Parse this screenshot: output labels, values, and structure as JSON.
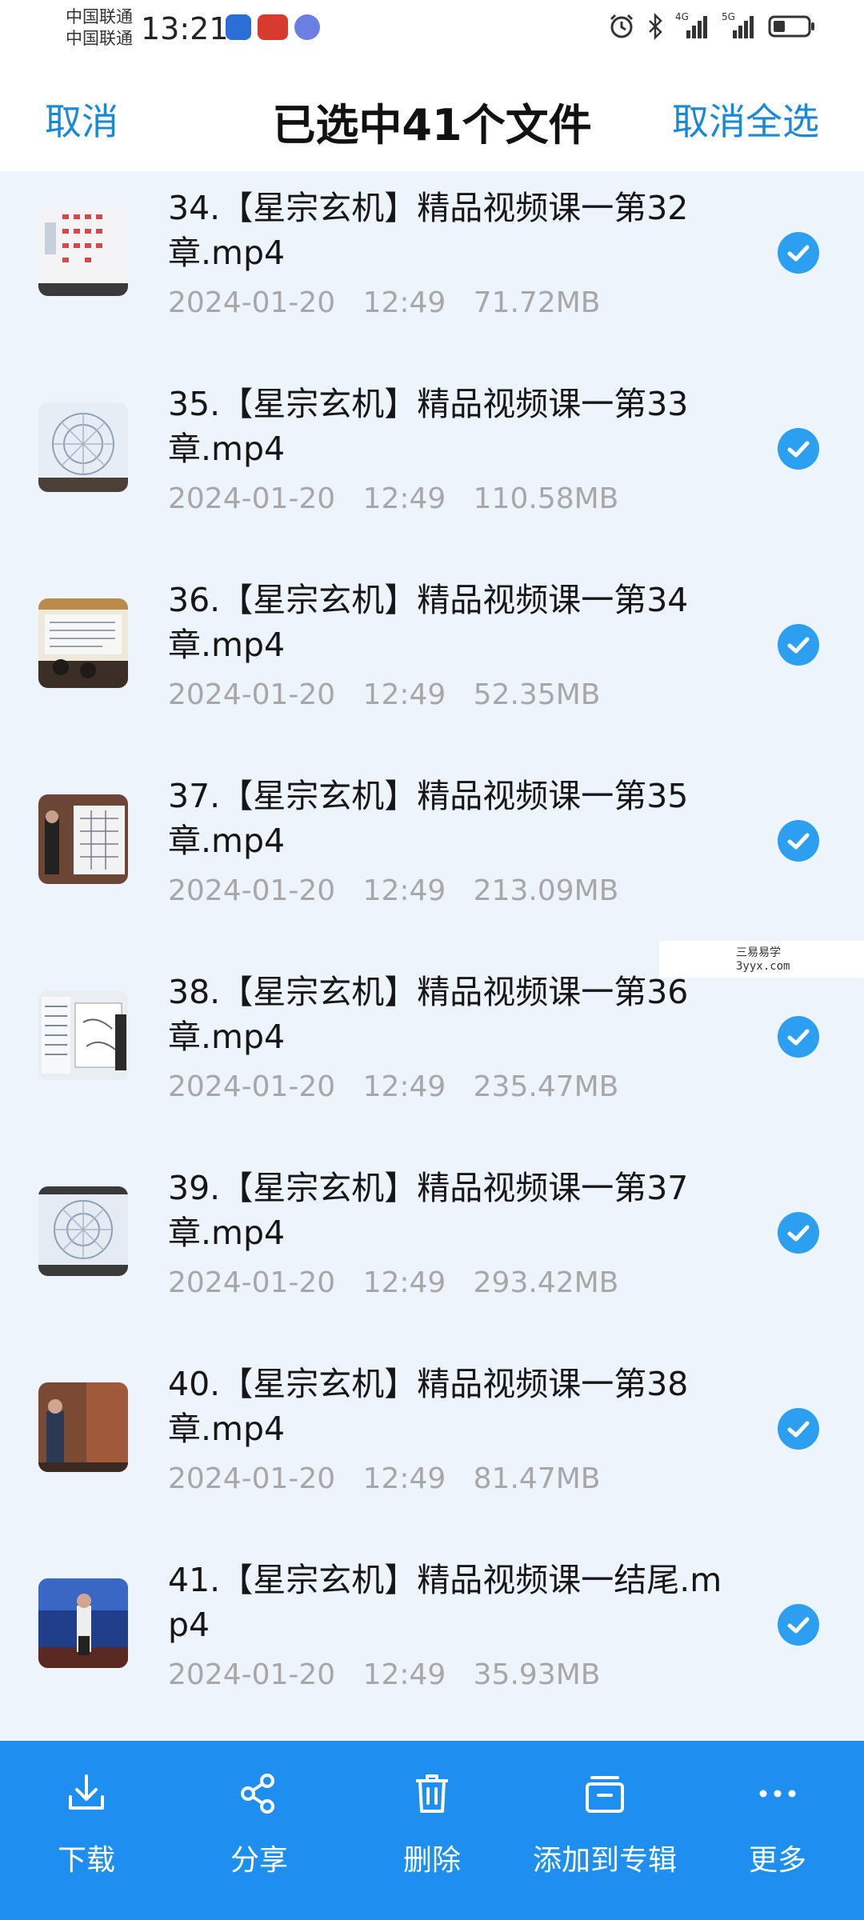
{
  "status_bar": {
    "carrier1": "中国联通",
    "carrier2": "中国联通",
    "time": "13:21",
    "net1": "4G",
    "net2": "5G"
  },
  "header": {
    "cancel": "取消",
    "title": "已选中41个文件",
    "deselect_all": "取消全选"
  },
  "files": [
    {
      "name": "34.【星宗玄机】精品视频课一第32章.mp4",
      "date": "2024-01-20",
      "time": "12:49",
      "size": "71.72MB",
      "selected": true
    },
    {
      "name": "35.【星宗玄机】精品视频课一第33章.mp4",
      "date": "2024-01-20",
      "time": "12:49",
      "size": "110.58MB",
      "selected": true
    },
    {
      "name": "36.【星宗玄机】精品视频课一第34章.mp4",
      "date": "2024-01-20",
      "time": "12:49",
      "size": "52.35MB",
      "selected": true
    },
    {
      "name": "37.【星宗玄机】精品视频课一第35章.mp4",
      "date": "2024-01-20",
      "time": "12:49",
      "size": "213.09MB",
      "selected": true
    },
    {
      "name": "38.【星宗玄机】精品视频课一第36章.mp4",
      "date": "2024-01-20",
      "time": "12:49",
      "size": "235.47MB",
      "selected": true
    },
    {
      "name": "39.【星宗玄机】精品视频课一第37章.mp4",
      "date": "2024-01-20",
      "time": "12:49",
      "size": "293.42MB",
      "selected": true
    },
    {
      "name": "40.【星宗玄机】精品视频课一第38章.mp4",
      "date": "2024-01-20",
      "time": "12:49",
      "size": "81.47MB",
      "selected": true
    },
    {
      "name": "41.【星宗玄机】精品视频课一结尾.mp4",
      "date": "2024-01-20",
      "time": "12:49",
      "size": "35.93MB",
      "selected": true
    }
  ],
  "watermark": {
    "line1": "三易易学",
    "line2": "3yyx.com"
  },
  "toolbar": {
    "download": "下载",
    "share": "分享",
    "delete": "删除",
    "add_to_album": "添加到专辑",
    "more": "更多"
  },
  "colors": {
    "accent": "#1e8fee",
    "check": "#2c9ff0",
    "link": "#1b88d6"
  }
}
